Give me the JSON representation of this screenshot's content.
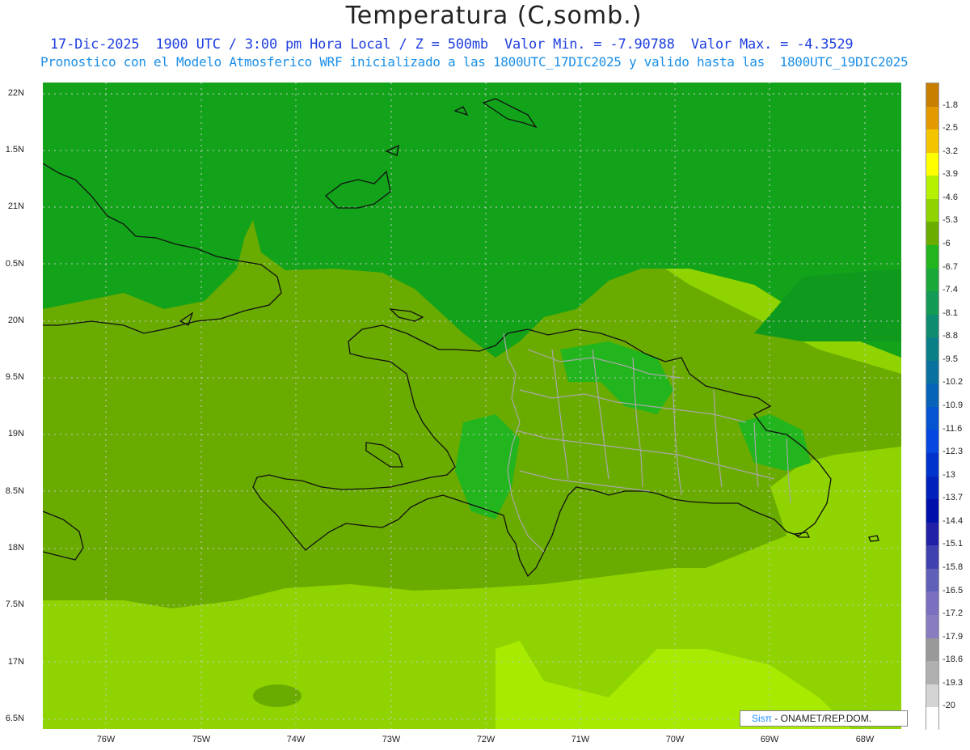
{
  "header": {
    "title": "Temperatura (C,somb.)",
    "subtitle1": "17-Dic-2025  1900 UTC / 3:00 pm Hora Local / Z = 500mb  Valor Min. = -7.90788  Valor Max. = -4.3529",
    "subtitle2": "Pronostico con el Modelo Atmosferico WRF inicializado a las 1800UTC_17DIC2025 y valido hasta las  1800UTC_19DIC2025"
  },
  "axes": {
    "lat_labels": [
      "22N",
      "1.5N",
      "21N",
      "0.5N",
      "20N",
      "9.5N",
      "19N",
      "8.5N",
      "18N",
      "7.5N",
      "17N",
      "6.5N"
    ],
    "lon_labels": [
      "76W",
      "75W",
      "74W",
      "73W",
      "72W",
      "71W",
      "70W",
      "69W",
      "68W"
    ]
  },
  "colorbar": {
    "labels": [
      "-1.8",
      "-2.5",
      "-3.2",
      "-3.9",
      "-4.6",
      "-5.3",
      "-6",
      "-6.7",
      "-7.4",
      "-8.1",
      "-8.8",
      "-9.5",
      "-10.2",
      "-10.9",
      "-11.6",
      "-12.3",
      "-13",
      "-13.7",
      "-14.4",
      "-15.1",
      "-15.8",
      "-16.5",
      "-17.2",
      "-17.9",
      "-18.6",
      "-19.3",
      "-20"
    ],
    "colors": [
      "#c87f00",
      "#e39a00",
      "#f5c400",
      "#ffff00",
      "#b5f000",
      "#8fd400",
      "#6aad00",
      "#22b51e",
      "#1aa83a",
      "#139a55",
      "#0e8c70",
      "#0a7f88",
      "#0871a0",
      "#0763b8",
      "#0655d0",
      "#0547e0",
      "#0033cc",
      "#0022bb",
      "#0010aa",
      "#2020a8",
      "#4040b0",
      "#6060b8",
      "#7a70c0",
      "#8a7cc0",
      "#999999",
      "#b0b0b0",
      "#d4d4d4",
      "#ffffff"
    ]
  },
  "fields": {
    "colors": {
      "cold": "#12a31a",
      "mid": "#6aab00",
      "warm": "#8fd300",
      "warmer": "#b0ef00"
    }
  },
  "credit": {
    "logo": "Sisπ",
    "text": "- ONAMET/REP.DOM."
  }
}
